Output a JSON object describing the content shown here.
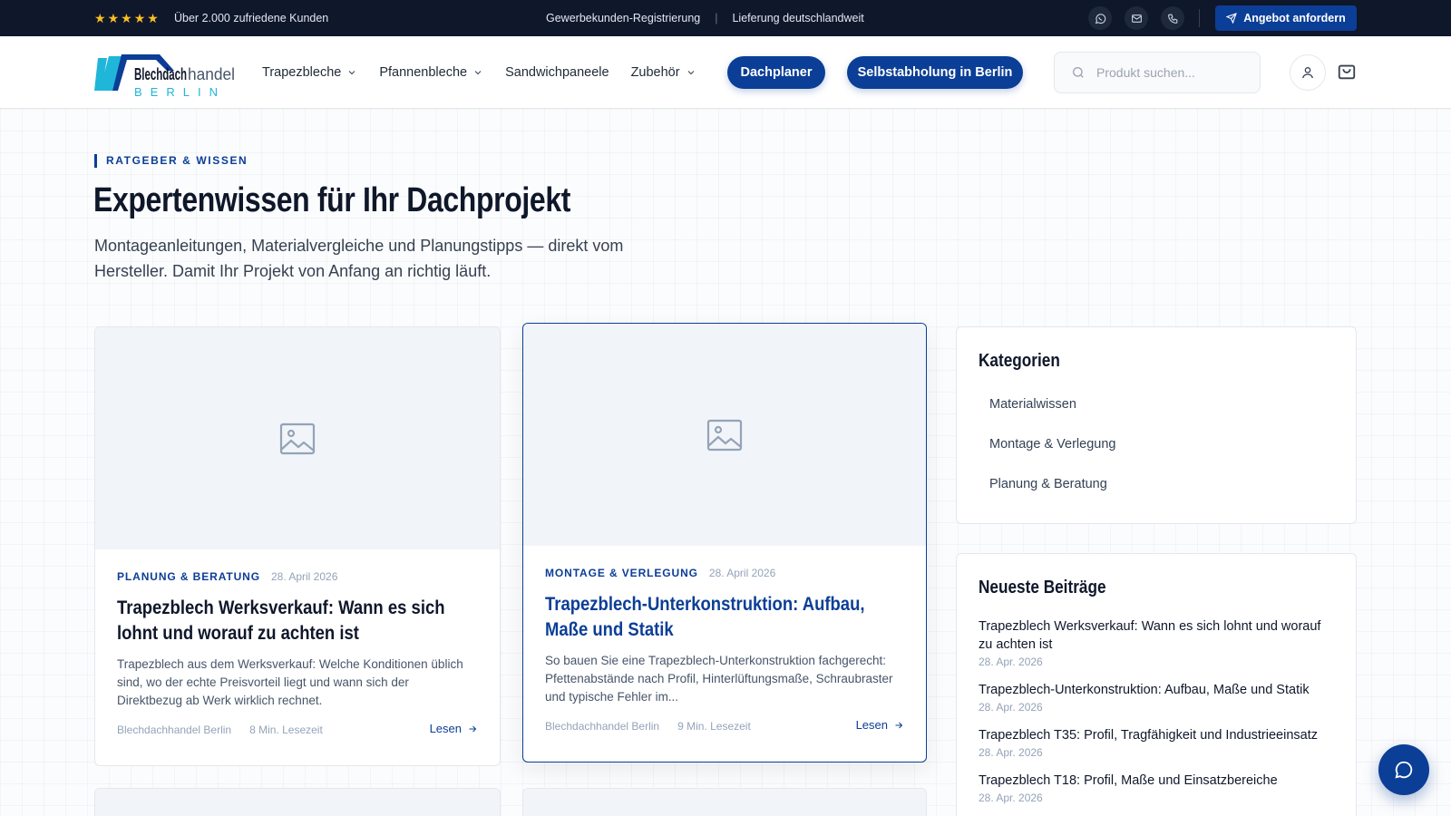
{
  "topbar": {
    "rating_stars": 5,
    "rating_text": "Über 2.000 zufriedene Kunden",
    "link_registration": "Gewerbekunden-Registrierung",
    "separator": "|",
    "delivery": "Lieferung deutschlandweit",
    "icons": [
      "whatsapp-icon",
      "mail-icon",
      "phone-icon"
    ],
    "offer_button": "Angebot anfordern"
  },
  "header": {
    "logo_word_1": "Blechdach",
    "logo_word_2": "handel",
    "logo_city": "BERLIN",
    "nav": [
      {
        "label": "Trapezbleche",
        "dropdown": true
      },
      {
        "label": "Pfannenbleche",
        "dropdown": true
      },
      {
        "label": "Sandwichpaneele",
        "dropdown": false
      },
      {
        "label": "Zubehör",
        "dropdown": true
      }
    ],
    "btn_planner": "Dachplaner",
    "btn_pickup": "Selbstabholung in Berlin",
    "search_placeholder": "Produkt suchen..."
  },
  "hero": {
    "eyebrow": "RATGEBER & WISSEN",
    "title": "Expertenwissen für Ihr Dachprojekt",
    "subtitle_line1": "Montageanleitungen, Materialvergleiche und Planungstipps — direkt vom",
    "subtitle_line2": "Hersteller. Damit Ihr Projekt von Anfang an richtig läuft."
  },
  "articles": [
    {
      "category": "PLANUNG & BERATUNG",
      "date": "28. April 2026",
      "title": "Trapezblech Werksverkauf: Wann es sich lohnt und worauf zu achten ist",
      "excerpt": "Trapezblech aus dem Werksverkauf: Welche Konditionen üblich sind, wo der echte Preisvorteil liegt und wann sich der Direktbezug ab Werk wirklich rechnet.",
      "author": "Blechdachhandel Berlin",
      "readtime": "8 Min. Lesezeit",
      "read_label": "Lesen"
    },
    {
      "category": "MONTAGE & VERLEGUNG",
      "date": "28. April 2026",
      "title": "Trapezblech-Unterkonstruktion: Aufbau, Maße und Statik",
      "excerpt": "So bauen Sie eine Trapezblech-Unterkonstruktion fachgerecht: Pfettenabstände nach Profil, Hinterlüftungsmaße, Schraubraster und typische Fehler im...",
      "author": "Blechdachhandel Berlin",
      "readtime": "9 Min. Lesezeit",
      "read_label": "Lesen"
    }
  ],
  "sidebar": {
    "categories_title": "Kategorien",
    "categories": [
      "Materialwissen",
      "Montage & Verlegung",
      "Planung & Beratung"
    ],
    "recent_title": "Neueste Beiträge",
    "recent": [
      {
        "title": "Trapezblech Werksverkauf: Wann es sich lohnt und worauf zu achten ist",
        "date": "28. Apr. 2026"
      },
      {
        "title": "Trapezblech-Unterkonstruktion: Aufbau, Maße und Statik",
        "date": "28. Apr. 2026"
      },
      {
        "title": "Trapezblech T35: Profil, Tragfähigkeit und Industrieeinsatz",
        "date": "28. Apr. 2026"
      },
      {
        "title": "Trapezblech T18: Profil, Maße und Einsatzbereiche",
        "date": "28. Apr. 2026"
      }
    ]
  },
  "colors": {
    "brand": "#0b3e96",
    "topbar_bg": "#0f172a",
    "logo_cyan": "#1fb6d9",
    "star": "#fbbf24"
  }
}
